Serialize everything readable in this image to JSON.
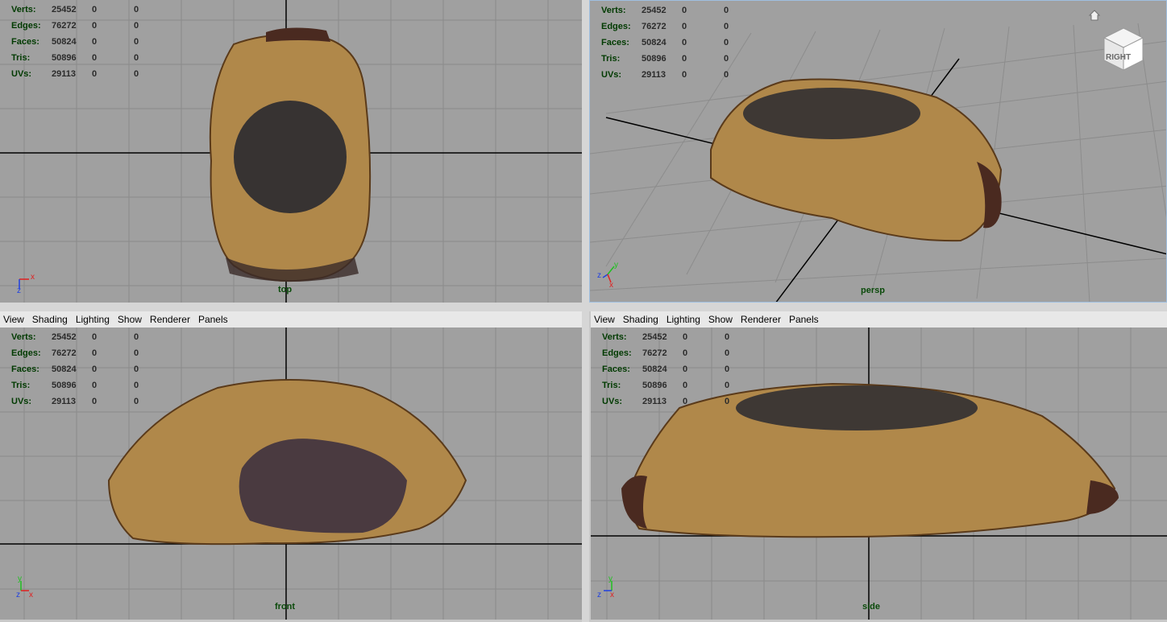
{
  "menu": {
    "items": [
      "View",
      "Shading",
      "Lighting",
      "Show",
      "Renderer",
      "Panels"
    ]
  },
  "hud": {
    "rows": [
      {
        "label": "Verts:",
        "v1": "25452",
        "v2": "0",
        "v3": "0"
      },
      {
        "label": "Edges:",
        "v1": "76272",
        "v2": "0",
        "v3": "0"
      },
      {
        "label": "Faces:",
        "v1": "50824",
        "v2": "0",
        "v3": "0"
      },
      {
        "label": "Tris:",
        "v1": "50896",
        "v2": "0",
        "v3": "0"
      },
      {
        "label": "UVs:",
        "v1": "29113",
        "v2": "0",
        "v3": "0"
      }
    ]
  },
  "panels": {
    "top": {
      "camera": "top",
      "axes": [
        "x",
        "z"
      ]
    },
    "persp": {
      "camera": "persp",
      "axes": [
        "y",
        "z",
        "x"
      ],
      "viewcube_label": "RIGHT"
    },
    "front": {
      "camera": "front",
      "axes": [
        "y",
        "z",
        "x"
      ]
    },
    "side": {
      "camera": "side",
      "axes": [
        "y",
        "z",
        "x"
      ]
    }
  },
  "colors": {
    "viewport_bg": "#a0a0a0",
    "grid_line": "#8a8a8a",
    "axis_line": "#000000",
    "active_border": "#9fbfe0",
    "hud_label": "#003a00",
    "axis_x": "#e02020",
    "axis_y": "#20c020",
    "axis_z": "#2040e0"
  },
  "icons": [
    "home-icon",
    "viewcube-icon",
    "axis-gizmo-icon"
  ]
}
